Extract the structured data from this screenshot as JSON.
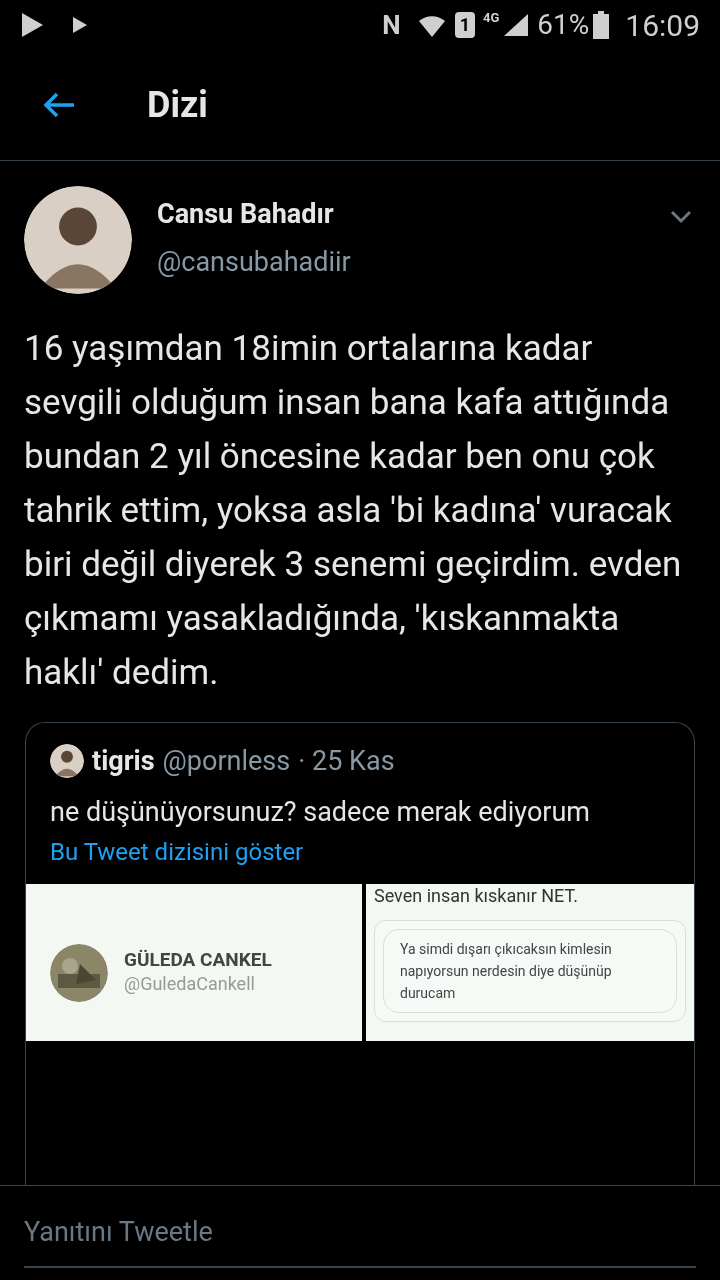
{
  "status_bar": {
    "nfc": "N",
    "sim": "1",
    "network": "4G",
    "battery": "61%",
    "time": "16:09"
  },
  "header": {
    "title": "Dizi"
  },
  "tweet": {
    "name": "Cansu Bahadır",
    "handle": "@cansubahadiir",
    "text": "16 yaşımdan 18imin ortalarına kadar sevgili olduğum insan bana kafa attığında bundan 2 yıl öncesine kadar ben onu çok tahrik ettim, yoksa asla 'bi kadına' vuracak biri değil diyerek 3 senemi geçirdim. evden çıkmamı yasakladığında, 'kıskanmakta haklı' dedim.",
    "quote": {
      "name": "tigris",
      "handle": "@pornless",
      "date": "· 25 Kas",
      "text": "ne düşünüyorsunuz? sadece merak ediyorum",
      "link": "Bu Tweet dizisini göster",
      "images": [
        {
          "kind": "profile",
          "name": "GÜLEDA CANKEL",
          "handle": "@GuledaCankell"
        },
        {
          "kind": "message",
          "caption": "Seven insan kıskanır NET.",
          "message": "Ya simdi dışarı çıkıcaksın kimlesin napıyorsun nerdesin diye düşünüp durucam"
        }
      ]
    }
  },
  "reply": {
    "placeholder": "Yanıtını Tweetle"
  }
}
